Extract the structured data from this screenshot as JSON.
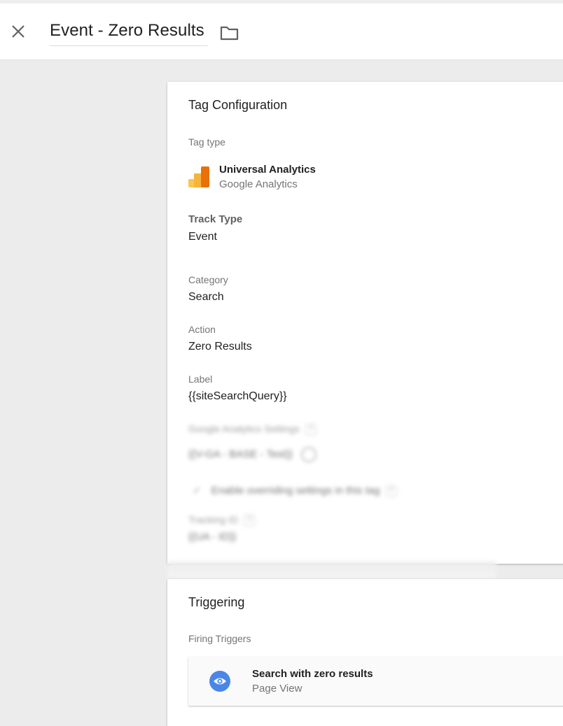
{
  "header": {
    "close_icon": "close-icon",
    "title": "Event - Zero Results",
    "folder_icon": "folder-icon"
  },
  "tag_configuration": {
    "title": "Tag Configuration",
    "tag_type_label": "Tag type",
    "tag_type": {
      "icon": "google-analytics-icon",
      "name": "Universal Analytics",
      "vendor": "Google Analytics"
    },
    "track_type": {
      "label": "Track Type",
      "value": "Event"
    },
    "category": {
      "label": "Category",
      "value": "Search"
    },
    "action": {
      "label": "Action",
      "value": "Zero Results"
    },
    "event_label": {
      "label": "Label",
      "value": "{{siteSearchQuery}}"
    },
    "blurred": {
      "ga_settings_label": "Google Analytics Settings",
      "ga_settings_value": "{{V-GA - BASE - Test}}",
      "override_checkbox": {
        "label": "Enable overriding settings in this tag",
        "checked": true
      },
      "tracking_id_label": "Tracking ID",
      "tracking_id_value": "{{UA - ID}}",
      "help_glyph": "?"
    }
  },
  "triggering": {
    "title": "Triggering",
    "firing_triggers_label": "Firing Triggers",
    "triggers": [
      {
        "icon": "eye-icon",
        "name": "Search with zero results",
        "type": "Page View",
        "icon_color": "#4a86e8"
      }
    ]
  },
  "colors": {
    "background": "#ececec",
    "ga_orange": "#e8710a",
    "ga_yellow": "#f9ab00",
    "trigger_blue": "#4a86e8"
  }
}
